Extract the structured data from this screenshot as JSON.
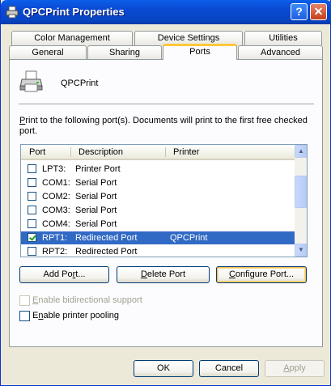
{
  "window": {
    "title": "QPCPrint Properties",
    "help_glyph": "?",
    "close_glyph": "✕"
  },
  "tabs_top": [
    "Color Management",
    "Device Settings",
    "Utilities"
  ],
  "tabs_bottom": [
    "General",
    "Sharing",
    "Ports",
    "Advanced"
  ],
  "active_tab": "Ports",
  "printer_name": "QPCPrint",
  "instructions": {
    "pre": "",
    "underlined": "P",
    "post": "rint to the following port(s). Documents will print to the first free checked port."
  },
  "columns": [
    "Port",
    "Description",
    "Printer"
  ],
  "ports": [
    {
      "port": "LPT3:",
      "description": "Printer Port",
      "printer": "",
      "checked": false,
      "selected": false
    },
    {
      "port": "COM1:",
      "description": "Serial Port",
      "printer": "",
      "checked": false,
      "selected": false
    },
    {
      "port": "COM2:",
      "description": "Serial Port",
      "printer": "",
      "checked": false,
      "selected": false
    },
    {
      "port": "COM3:",
      "description": "Serial Port",
      "printer": "",
      "checked": false,
      "selected": false
    },
    {
      "port": "COM4:",
      "description": "Serial Port",
      "printer": "",
      "checked": false,
      "selected": false
    },
    {
      "port": "RPT1:",
      "description": "Redirected Port",
      "printer": "QPCPrint",
      "checked": true,
      "selected": true
    },
    {
      "port": "RPT2:",
      "description": "Redirected Port",
      "printer": "",
      "checked": false,
      "selected": false
    }
  ],
  "buttons": {
    "add_port": {
      "pre": "Add Po",
      "u": "r",
      "post": "t..."
    },
    "delete_port": {
      "pre": "",
      "u": "D",
      "post": "elete Port"
    },
    "configure_port": {
      "pre": "",
      "u": "C",
      "post": "onfigure Port..."
    }
  },
  "options": {
    "bidirectional": {
      "pre": "",
      "u": "E",
      "post": "nable bidirectional support",
      "checked": false,
      "disabled": true
    },
    "pooling": {
      "pre": "E",
      "u": "n",
      "post": "able printer pooling",
      "checked": false,
      "disabled": false
    }
  },
  "dialog_buttons": {
    "ok": "OK",
    "cancel": "Cancel",
    "apply": {
      "pre": "",
      "u": "A",
      "post": "pply"
    }
  },
  "colors": {
    "titlebar": "#0a5fe8",
    "selection": "#316ac5",
    "tab_highlight": "#ffc83c"
  }
}
